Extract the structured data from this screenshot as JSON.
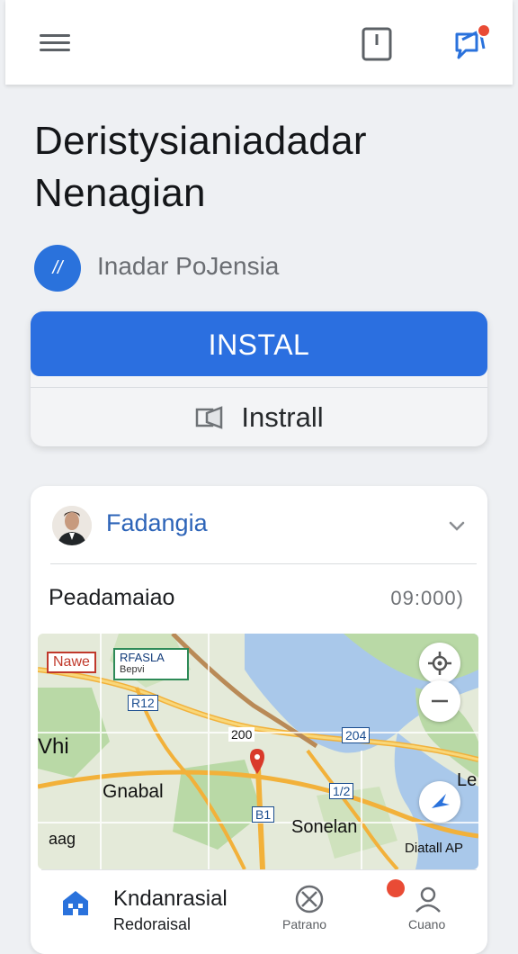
{
  "header": {
    "menu_icon": "hamburger-menu-icon",
    "tablet_icon": "tablet-icon",
    "messages_icon": "chat-bubble-icon"
  },
  "app": {
    "title_line1": "Deristysianiadadar",
    "title_line2": "Nenagian",
    "developer": "Inadar PoJensia",
    "developer_logo_text": "//"
  },
  "install": {
    "primary_label": "INSTAL",
    "secondary_label": "Instrall"
  },
  "card": {
    "author_name": "Fadangia",
    "row_label": "Peadamaiao",
    "row_time": "09:000)"
  },
  "map": {
    "labels": {
      "nawe": "Nawe",
      "rfasla": "RFASLA",
      "bepvi": "Bepvi",
      "r12": "R12",
      "vhi": "Vhi",
      "n200": "200",
      "n204": "204",
      "gnabal": "Gnabal",
      "n172": "1/2",
      "b1": "B1",
      "sonelan": "Sonelan",
      "le": "Le",
      "oag": "aag",
      "diatall": "Diatall AP"
    },
    "colors": {
      "water": "#a9c8ea",
      "land": "#dfe8d5",
      "park": "#b9d9a6",
      "road": "#f4c64a",
      "pin": "#d93a2b"
    }
  },
  "bottom_nav": {
    "home_title": "Kndanrasial",
    "home_sub": "Redoraisal",
    "compass_label": "Patrano",
    "profile_label": "Cuano"
  }
}
